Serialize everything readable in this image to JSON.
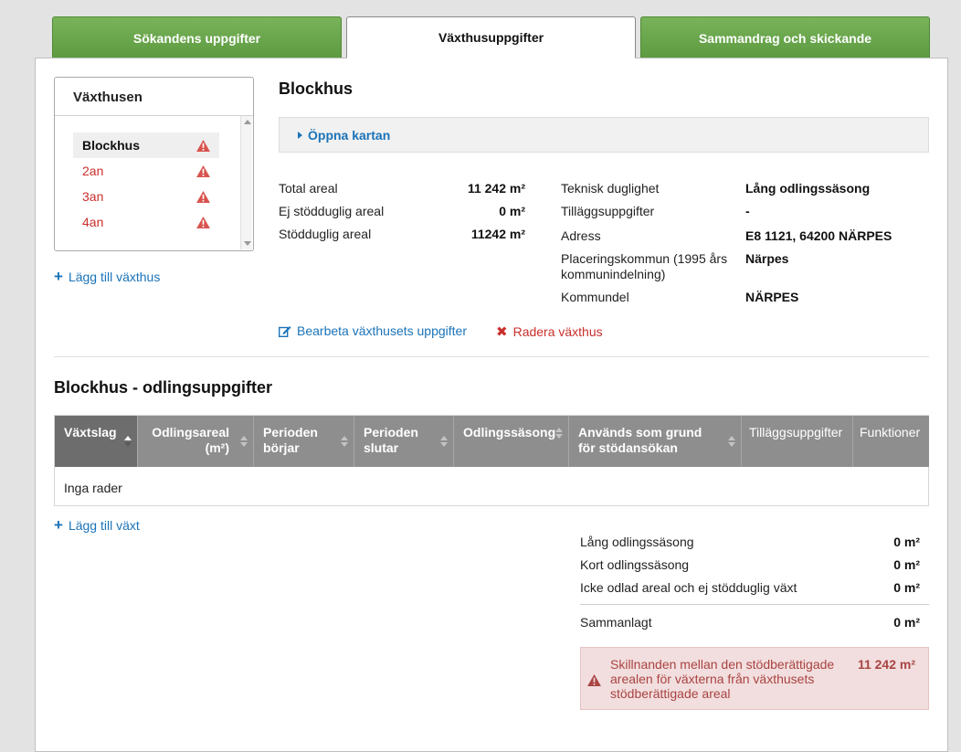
{
  "tabs": [
    {
      "label": "Sökandens uppgifter",
      "state": "complete"
    },
    {
      "label": "Växthusuppgifter",
      "state": "active"
    },
    {
      "label": "Sammandrag och skickande",
      "state": "complete"
    }
  ],
  "greenhouses": {
    "title": "Växthusen",
    "items": [
      {
        "label": "Blockhus",
        "selected": true,
        "warning": true
      },
      {
        "label": "2an",
        "selected": false,
        "warning": true
      },
      {
        "label": "3an",
        "selected": false,
        "warning": true
      },
      {
        "label": "4an",
        "selected": false,
        "warning": true
      }
    ],
    "add_label": "Lägg till växthus"
  },
  "detail": {
    "title": "Blockhus",
    "map_link": "Öppna kartan",
    "left_fields": [
      {
        "label": "Total areal",
        "value": "11 242 m²"
      },
      {
        "label": "Ej stödduglig areal",
        "value": "0 m²"
      },
      {
        "label": "Stödduglig areal",
        "value": "11242 m²"
      }
    ],
    "right_fields": [
      {
        "label": "Teknisk duglighet",
        "value": "Lång odlingssäsong"
      },
      {
        "label": "Tilläggsuppgifter",
        "value": "-"
      },
      {
        "label": "Adress",
        "value": "E8 1121, 64200 NÄRPES"
      },
      {
        "label": "Placeringskommun (1995 års kommunindelning)",
        "value": "Närpes"
      },
      {
        "label": "Kommundel",
        "value": "NÄRPES"
      }
    ],
    "edit_label": "Bearbeta växthusets uppgifter",
    "delete_label": "Radera växthus"
  },
  "cultivation": {
    "title": "Blockhus - odlingsuppgifter",
    "columns": [
      {
        "label": "Växtslag",
        "sortable": true,
        "sorted": "asc"
      },
      {
        "label": "Odlingsareal (m²)",
        "sortable": true
      },
      {
        "label": "Perioden börjar",
        "sortable": true
      },
      {
        "label": "Perioden slutar",
        "sortable": true
      },
      {
        "label": "Odlingssäsong",
        "sortable": true
      },
      {
        "label": "Används som grund för stödansökan",
        "sortable": true
      },
      {
        "label": "Tilläggsuppgifter",
        "sortable": false
      },
      {
        "label": "Funktioner",
        "sortable": false
      }
    ],
    "empty_text": "Inga rader",
    "add_label": "Lägg till växt"
  },
  "summary": {
    "rows": [
      {
        "label": "Lång odlingssäsong",
        "value": "0 m²"
      },
      {
        "label": "Kort odlingssäsong",
        "value": "0 m²"
      },
      {
        "label": "Icke odlad areal och ej stödduglig växt",
        "value": "0 m²"
      }
    ],
    "total": {
      "label": "Sammanlagt",
      "value": "0 m²"
    },
    "alert": {
      "text": "Skillnanden mellan den stödberättigade arealen för växterna från växthusets stödberättigade areal",
      "value": "11 242 m²"
    }
  },
  "colors": {
    "tab_green": "#6aa84f",
    "link": "#1a73b8",
    "danger": "#c9302c",
    "table_header": "#8e8e8e",
    "alert_bg": "#f2dede"
  },
  "icons": [
    "warning-icon",
    "plus-icon",
    "edit-icon",
    "times-icon",
    "caret-right-icon",
    "sort-icon"
  ]
}
